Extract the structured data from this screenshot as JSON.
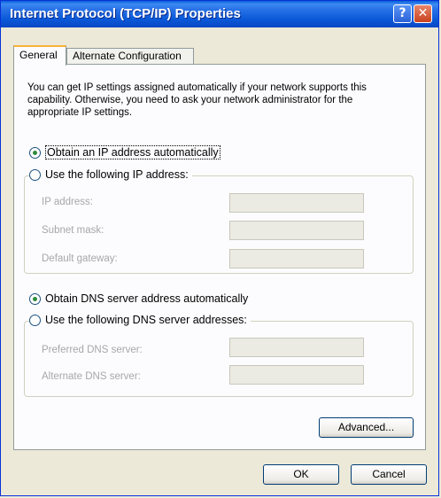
{
  "window": {
    "title": "Internet Protocol (TCP/IP) Properties",
    "help_button": "?",
    "close_button": "✕"
  },
  "tabs": [
    {
      "label": "General",
      "selected": true
    },
    {
      "label": "Alternate Configuration",
      "selected": false
    }
  ],
  "intro_text": "You can get IP settings assigned automatically if your network supports this capability. Otherwise, you need to ask your network administrator for the appropriate IP settings.",
  "ip": {
    "auto_label": "Obtain an IP address automatically",
    "auto_selected": true,
    "manual_label": "Use the following IP address:",
    "manual_selected": false,
    "fields": [
      {
        "label": "IP address:",
        "value": ""
      },
      {
        "label": "Subnet mask:",
        "value": ""
      },
      {
        "label": "Default gateway:",
        "value": ""
      }
    ]
  },
  "dns": {
    "auto_label": "Obtain DNS server address automatically",
    "auto_selected": true,
    "manual_label": "Use the following DNS server addresses:",
    "manual_selected": false,
    "fields": [
      {
        "label": "Preferred DNS server:",
        "value": ""
      },
      {
        "label": "Alternate DNS server:",
        "value": ""
      }
    ]
  },
  "buttons": {
    "advanced": "Advanced...",
    "ok": "OK",
    "cancel": "Cancel"
  }
}
